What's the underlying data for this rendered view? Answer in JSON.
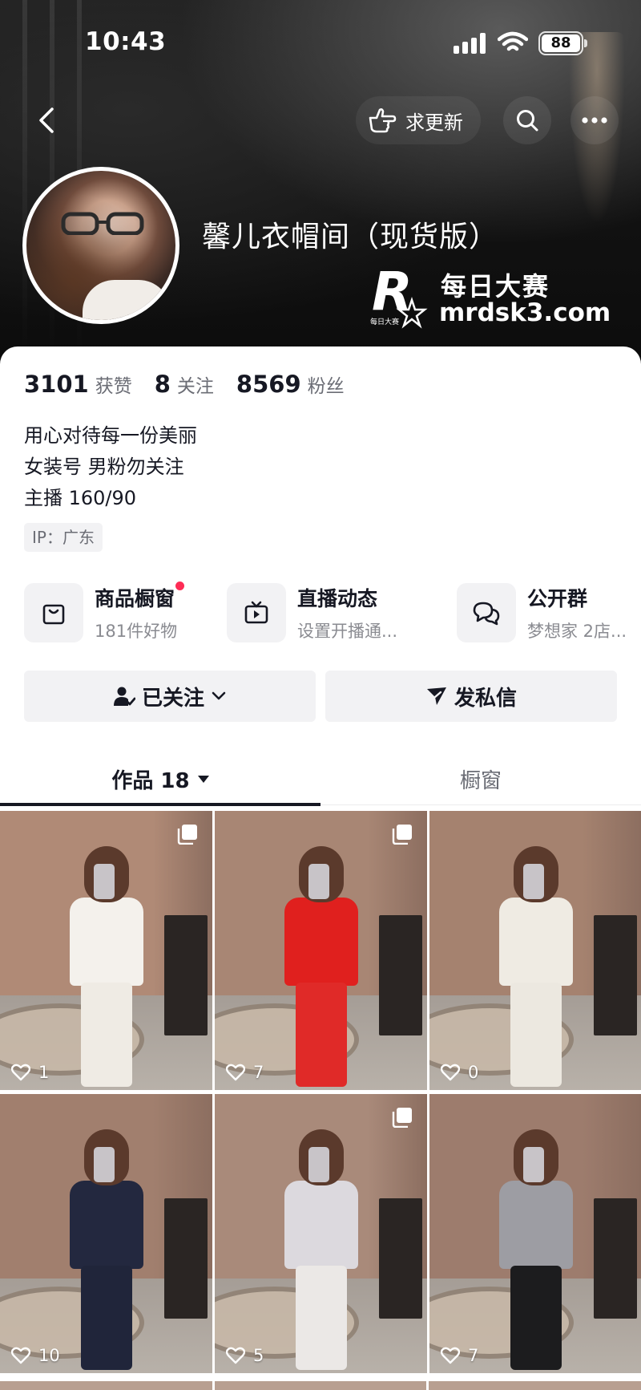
{
  "status_bar": {
    "time": "10:43",
    "battery": "88"
  },
  "top_nav": {
    "request_update": "求更新"
  },
  "profile": {
    "name": "馨儿衣帽间（现货版）",
    "watermark_cn": "每日大赛",
    "watermark_url": "mrdsk3.com",
    "watermark_logo_text": "每日大赛",
    "stats": [
      {
        "value": "3101",
        "label": "获赞"
      },
      {
        "value": "8",
        "label": "关注"
      },
      {
        "value": "8569",
        "label": "粉丝"
      }
    ],
    "bio": [
      "用心对待每一份美丽",
      "女装号 男粉勿关注",
      "主播 160/90"
    ],
    "ip": "IP：广东"
  },
  "features": [
    {
      "title": "商品橱窗",
      "sub": "181件好物",
      "icon": "shopping-bag-icon",
      "dot": true
    },
    {
      "title": "直播动态",
      "sub": "设置开播通...",
      "icon": "tv-icon",
      "dot": false
    },
    {
      "title": "公开群",
      "sub": "梦想家 2店...",
      "icon": "chat-bubbles-icon",
      "dot": false
    }
  ],
  "actions": {
    "followed": "已关注",
    "message": "发私信"
  },
  "tabs": {
    "works": "作品 18",
    "showcase": "橱窗"
  },
  "posts": [
    {
      "likes": "1",
      "multi": true,
      "top": "#f4f1ec",
      "bottom": "#efebe4"
    },
    {
      "likes": "7",
      "multi": true,
      "top": "#e0201e",
      "bottom": "#e02a28"
    },
    {
      "likes": "0",
      "multi": false,
      "top": "#efebe3",
      "bottom": "#ece8e0"
    },
    {
      "likes": "10",
      "multi": false,
      "top": "#23283f",
      "bottom": "#20253a"
    },
    {
      "likes": "5",
      "multi": true,
      "top": "#dcd9de",
      "bottom": "#ebe8e6"
    },
    {
      "likes": "7",
      "multi": false,
      "top": "#9d9da3",
      "bottom": "#1c1c1e"
    }
  ],
  "colors": {
    "accent": "#fe2c55",
    "text": "#161823",
    "muted": "#6b6d75"
  }
}
